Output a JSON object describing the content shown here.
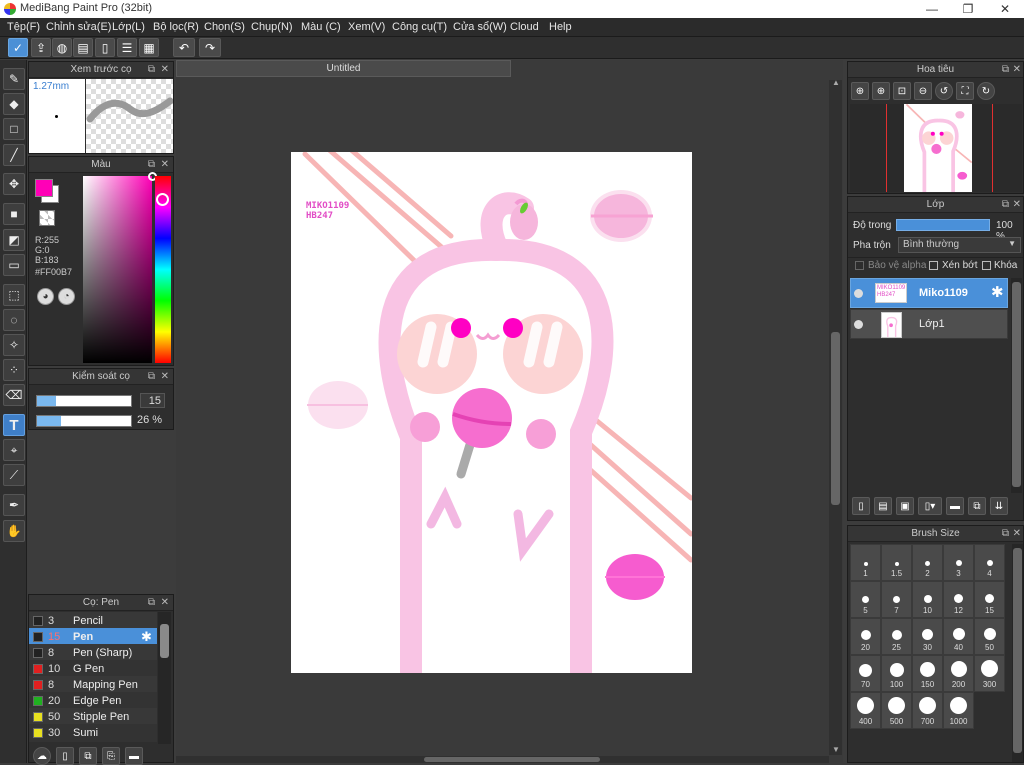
{
  "window": {
    "title": "MediBang Paint Pro (32bit)",
    "minimize": "—",
    "maximize": "❐",
    "close": "✕"
  },
  "menu": [
    "Tệp(F)",
    "Chỉnh sửa(E)",
    "Lớp(L)",
    "Bộ lọc(R)",
    "Chọn(S)",
    "Chụp(N)",
    "Màu (C)",
    "Xem(V)",
    "Công cụ(T)",
    "Cửa sổ(W)",
    "Cloud",
    "Help"
  ],
  "toolbar": {
    "undo": "↶",
    "redo": "↷"
  },
  "brush_preview": {
    "title": "Xem trước cọ",
    "size": "1.27mm"
  },
  "color_panel": {
    "title": "Màu",
    "r": "R:255",
    "g": "G:0",
    "b": "B:183",
    "hex": "#FF00B7",
    "primary_color": "#FF00B7"
  },
  "brush_control": {
    "title": "Kiểm soát cọ",
    "size_value": "15",
    "opacity_value": "26 %",
    "size_fill": 0.2,
    "opacity_fill": 0.26
  },
  "brush_list": {
    "title": "Cọ: Pen",
    "items": [
      {
        "size": "3",
        "name": "Pencil",
        "color": "#222222",
        "selected": false
      },
      {
        "size": "15",
        "name": "Pen",
        "color": "#222222",
        "selected": true
      },
      {
        "size": "8",
        "name": "Pen (Sharp)",
        "color": "#222222",
        "selected": false
      },
      {
        "size": "10",
        "name": "G Pen",
        "color": "#e02020",
        "selected": false
      },
      {
        "size": "8",
        "name": "Mapping Pen",
        "color": "#e02020",
        "selected": false
      },
      {
        "size": "20",
        "name": "Edge Pen",
        "color": "#20b020",
        "selected": false
      },
      {
        "size": "50",
        "name": "Stipple Pen",
        "color": "#e8e020",
        "selected": false
      },
      {
        "size": "30",
        "name": "Sumi",
        "color": "#e8e020",
        "selected": false
      }
    ]
  },
  "document": {
    "tab": "Untitled",
    "signature": [
      "MIKO1109",
      "HB247"
    ]
  },
  "navigator": {
    "title": "Hoa tiêu"
  },
  "layers": {
    "title": "Lớp",
    "opacity_label": "Độ trong",
    "opacity_value": "100 %",
    "blend_label": "Pha trộn",
    "blend_value": "Bình thường",
    "protect_alpha": "Bảo vệ alpha",
    "clipping": "Xén bớt",
    "lock": "Khóa",
    "items": [
      {
        "name": "Miko1109",
        "selected": true
      },
      {
        "name": "Lớp1",
        "selected": false
      }
    ]
  },
  "brush_size": {
    "title": "Brush Size",
    "sizes": [
      "1",
      "1.5",
      "2",
      "3",
      "4",
      "5",
      "7",
      "10",
      "12",
      "15",
      "20",
      "25",
      "30",
      "40",
      "50",
      "70",
      "100",
      "150",
      "200",
      "300",
      "400",
      "500",
      "700",
      "1000"
    ]
  },
  "colors": {
    "accent": "#4a90d9",
    "pink": "#ff00b7",
    "art_pink": "#f7b3dc"
  }
}
